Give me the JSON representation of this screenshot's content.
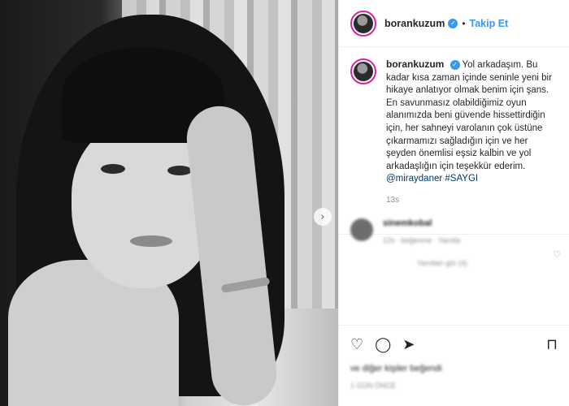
{
  "post": {
    "username": "borankuzum",
    "verified_mark": "✓",
    "follow_label": "Takip Et",
    "separator": "•",
    "caption_text": "Yol arkadaşım. Bu kadar kısa zaman içinde seninle yeni bir hikaye anlatıyor olmak benim için şans. En savunmasız olabildiğimiz oyun alanımızda beni güvende hissettirdiğin için, her sahneyi varolanın çok üstüne çıkarmamızı sağladığın için ve her şeyden önemlisi eşsiz kalbin ve yol arkadaşlığın için teşekkür ederim.",
    "mention": "@miraydaner",
    "hashtag": "#SAYGI",
    "time_ago": "13s"
  },
  "comment": {
    "username": "sinemkobal",
    "meta": "12s  ·  beğenme  ·  Yanıtla",
    "replies_label": "Yanıtları gör (4)"
  },
  "actions": {
    "like_icon": "heart-icon",
    "comment_icon": "comment-icon",
    "share_icon": "share-icon",
    "save_icon": "bookmark-icon",
    "likes_text": "ve diğer kişiler beğendi",
    "date_text": "1 GÜN ÖNCE"
  },
  "carousel": {
    "next_glyph": "›"
  },
  "colors": {
    "accent_blue": "#3897f0",
    "mention_blue": "#00376b",
    "text": "#262626",
    "muted": "#8e8e8e"
  }
}
